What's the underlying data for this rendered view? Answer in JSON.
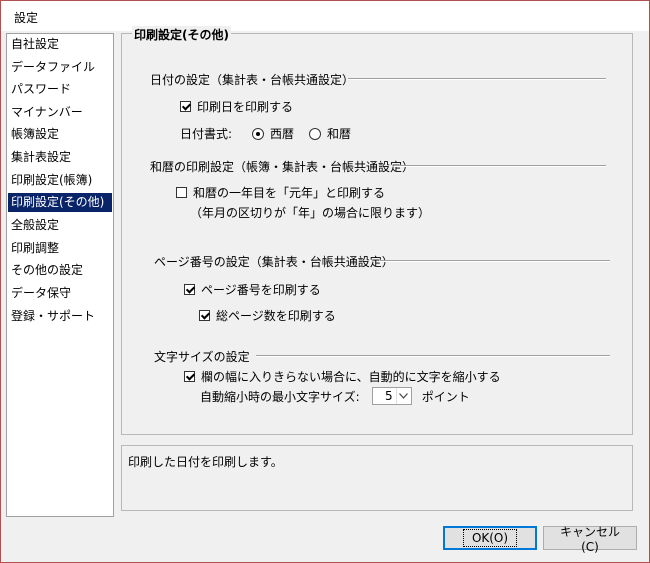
{
  "window": {
    "title": "設定"
  },
  "sidebar": {
    "items": [
      {
        "label": "自社設定"
      },
      {
        "label": "データファイル"
      },
      {
        "label": "パスワード"
      },
      {
        "label": "マイナンバー"
      },
      {
        "label": "帳簿設定"
      },
      {
        "label": "集計表設定"
      },
      {
        "label": "印刷設定(帳簿)"
      },
      {
        "label": "印刷設定(その他)",
        "selected": true
      },
      {
        "label": "全般設定"
      },
      {
        "label": "印刷調整"
      },
      {
        "label": "その他の設定"
      },
      {
        "label": "データ保守"
      },
      {
        "label": "登録・サポート"
      }
    ]
  },
  "main": {
    "title": "印刷設定(その他)",
    "date_group": {
      "label": "日付の設定（集計表・台帳共通設定）",
      "print_date": {
        "label": "印刷日を印刷する",
        "checked": true
      },
      "format_label": "日付書式:",
      "options": [
        {
          "label": "西暦",
          "checked": true
        },
        {
          "label": "和暦",
          "checked": false
        }
      ]
    },
    "era_group": {
      "label": "和暦の印刷設定（帳簿・集計表・台帳共通設定）",
      "first_year": {
        "label": "和暦の一年目を「元年」と印刷する",
        "checked": false
      },
      "note": "（年月の区切りが「年」の場合に限ります）"
    },
    "page_group": {
      "label": "ページ番号の設定（集計表・台帳共通設定）",
      "print_page": {
        "label": "ページ番号を印刷する",
        "checked": true
      },
      "print_total": {
        "label": "総ページ数を印刷する",
        "checked": true
      }
    },
    "font_group": {
      "label": "文字サイズの設定",
      "shrink": {
        "label": "欄の幅に入りきらない場合に、自動的に文字を縮小する",
        "checked": true
      },
      "min_size_label": "自動縮小時の最小文字サイズ:",
      "min_size_value": "5",
      "unit": "ポイント"
    }
  },
  "description": "印刷した日付を印刷します。",
  "buttons": {
    "ok": "OK(O)",
    "cancel": "キャンセル(C)"
  }
}
